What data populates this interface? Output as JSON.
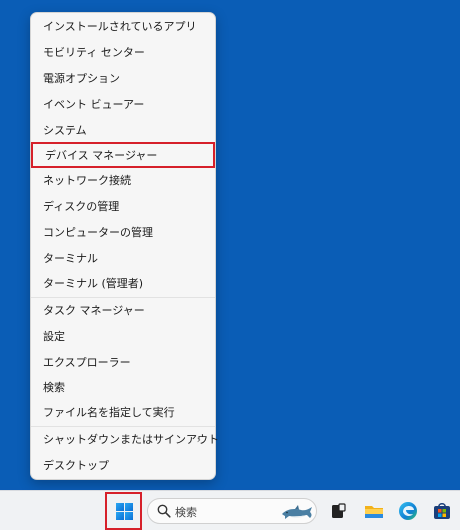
{
  "menu": {
    "items": [
      {
        "label": "インストールされているアプリ"
      },
      {
        "label": "モビリティ センター"
      },
      {
        "label": "電源オプション"
      },
      {
        "label": "イベント ビューアー"
      },
      {
        "label": "システム"
      },
      {
        "label": "デバイス マネージャー"
      },
      {
        "label": "ネットワーク接続"
      },
      {
        "label": "ディスクの管理"
      },
      {
        "label": "コンピューターの管理"
      },
      {
        "label": "ターミナル"
      },
      {
        "label": "ターミナル (管理者)"
      },
      {
        "label": "タスク マネージャー"
      },
      {
        "label": "設定"
      },
      {
        "label": "エクスプローラー"
      },
      {
        "label": "検索"
      },
      {
        "label": "ファイル名を指定して実行"
      },
      {
        "label": "シャットダウンまたはサインアウト"
      },
      {
        "label": "デスクトップ"
      }
    ],
    "highlighted_item": "デバイス マネージャー"
  },
  "taskbar": {
    "search_label": "検索",
    "icons": [
      "windows-start-icon",
      "search-icon",
      "task-view-icon",
      "file-explorer-icon",
      "edge-icon",
      "store-icon"
    ]
  },
  "colors": {
    "desktop": "#0a5db6",
    "highlight_box": "#d6202a",
    "menu_bg": "#f6f6f6",
    "taskbar_bg": "#f0f2f4"
  }
}
